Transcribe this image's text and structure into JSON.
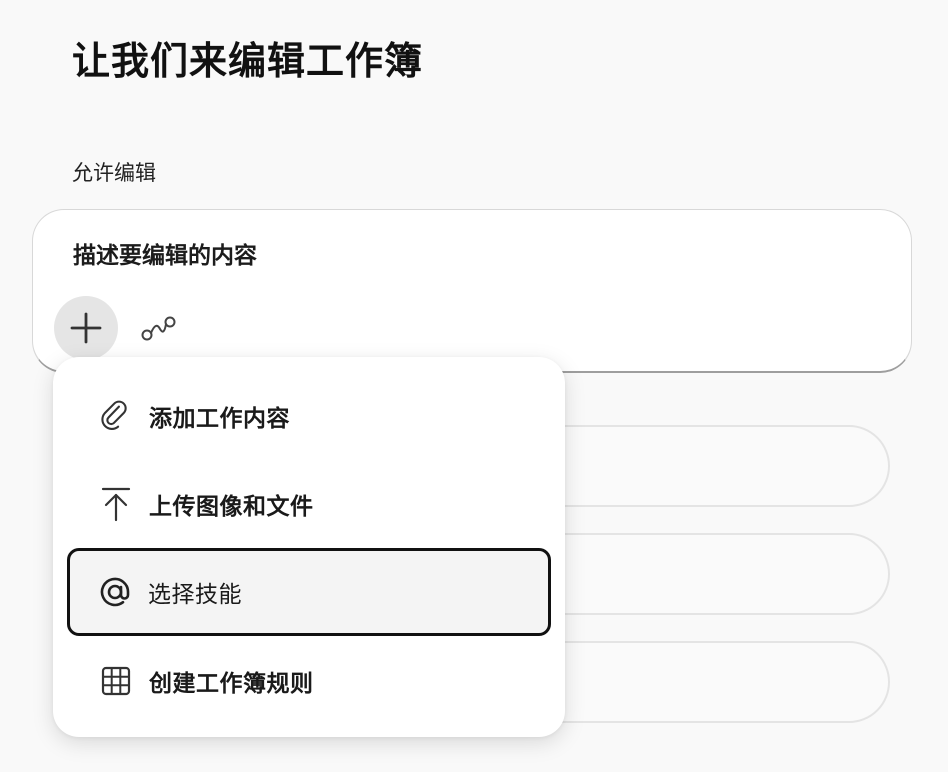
{
  "header": {
    "title": "让我们来编辑工作簿"
  },
  "edit_section": {
    "label": "允许编辑"
  },
  "prompt": {
    "placeholder": "描述要编辑的内容",
    "add_icon": "plus-icon",
    "connector_icon": "connector-icon"
  },
  "menu": {
    "items": [
      {
        "label": "添加工作内容",
        "icon": "paperclip-icon"
      },
      {
        "label": "上传图像和文件",
        "icon": "upload-icon"
      },
      {
        "label": "选择技能",
        "icon": "at-icon",
        "selected": true
      },
      {
        "label": "创建工作簿规则",
        "icon": "grid-icon"
      }
    ]
  },
  "colors": {
    "background": "#f9f9f9",
    "card": "#ffffff",
    "selected_border": "#111111",
    "add_button_bg": "#e5e5e5"
  }
}
